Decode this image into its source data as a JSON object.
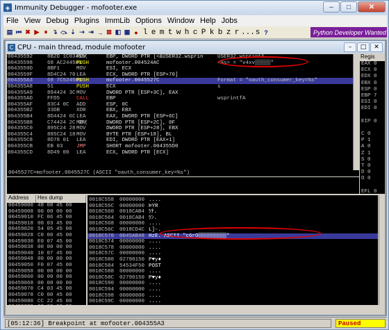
{
  "window": {
    "title": "Immunity Debugger - mofooter.exe",
    "min": "–",
    "max": "□",
    "close": "✕"
  },
  "menu": [
    "File",
    "View",
    "Debug",
    "Plugins",
    "ImmLib",
    "Options",
    "Window",
    "Help",
    "Jobs"
  ],
  "toolbar": {
    "letters": [
      "l",
      "e",
      "m",
      "t",
      "w",
      "h",
      "c",
      "P",
      "k",
      "b",
      "z",
      "r",
      "...",
      "s"
    ],
    "python_banner": "Python Developer Wanted"
  },
  "cpu": {
    "title": "CPU - main thread, module mofooter",
    "disasm": [
      {
        "addr": "00435592",
        "hex": "8B2D 1C03450(",
        "mn": "MOV",
        "op": "EBP, DWORD PTR [<&USER32.wsprin",
        "cm": "USER32.wsprintA",
        "cls": "m-mov"
      },
      {
        "addr": "00435598",
        "hex": "68 AC244500",
        "mn": "PUSH",
        "op": "mofooter.004524AC",
        "cm": "<%s> = \"v4xv▒▒▒▒▒\"",
        "cls": "m-push"
      },
      {
        "addr": "0043559D",
        "hex": "8BF1",
        "mn": "MOV",
        "op": "ESI, ECX",
        "cm": "",
        "cls": "m-mov"
      },
      {
        "addr": "0043559F",
        "hex": "8D4C24 70",
        "mn": "LEA",
        "op": "ECX, DWORD PTR [ESP+70]",
        "cm": "",
        "cls": "m-lea"
      },
      {
        "addr": "004355A3",
        "hex": "68 7C524500",
        "mn": "PUSH",
        "op": "mofooter.0045527C",
        "cm": "Format = \"oauth_consumer_key=%s\"",
        "cls": "m-push",
        "sel": true
      },
      {
        "addr": "004355A8",
        "hex": "51",
        "mn": "PUSH",
        "op": "ECX",
        "cm": "s",
        "cls": "m-push"
      },
      {
        "addr": "004355A9",
        "hex": "894424 3C",
        "mn": "MOV",
        "op": "DWORD PTR [ESP+3C], EAX",
        "cm": "",
        "cls": "m-mov"
      },
      {
        "addr": "004355AD",
        "hex": "FFD5",
        "mn": "CALL",
        "op": "EBP",
        "cm": "wsprintfA",
        "cls": "m-call"
      },
      {
        "addr": "004355AF",
        "hex": "83C4 0C",
        "mn": "ADD",
        "op": "ESP, 0C",
        "cm": "",
        "cls": "m-add"
      },
      {
        "addr": "004355B2",
        "hex": "33DB",
        "mn": "XOR",
        "op": "EBX, EBX",
        "cm": "",
        "cls": "m-xor"
      },
      {
        "addr": "004355B4",
        "hex": "8D4424 6C",
        "mn": "LEA",
        "op": "EAX, DWORD PTR [ESP+6C]",
        "cm": "",
        "cls": "m-lea"
      },
      {
        "addr": "004355B8",
        "hex": "C74424 2C 0F(",
        "mn": "MOV",
        "op": "DWORD PTR [ESP+2C], 0F",
        "cm": "",
        "cls": "m-mov"
      },
      {
        "addr": "004355C0",
        "hex": "895C24 28",
        "mn": "MOV",
        "op": "DWORD PTR [ESP+28], EBX",
        "cm": "",
        "cls": "m-mov"
      },
      {
        "addr": "004355C4",
        "hex": "885C24 18",
        "mn": "MOV",
        "op": "BYTE PTR [ESP+18], BL",
        "cm": "",
        "cls": "m-mov"
      },
      {
        "addr": "004355C8",
        "hex": "8D78 01",
        "mn": "LEA",
        "op": "EDI, DWORD PTR [EAX+1]",
        "cm": "",
        "cls": "m-lea"
      },
      {
        "addr": "004355CB",
        "hex": "EB 03",
        "mn": "JMP",
        "op": "SHORT mofooter.004355D0",
        "cm": "",
        "cls": "m-jmp"
      },
      {
        "addr": "004355CD",
        "hex": "8D49 00",
        "mn": "LEA",
        "op": "ECX, DWORD PTR [ECX]",
        "cm": "",
        "cls": "m-lea"
      }
    ],
    "info_line": "0045527C=mofooter.0045527C (ASCII \"oauth_consumer_key=%s\")",
    "registers_title": "Regis",
    "registers": [
      "EAX 0",
      "ECX 0",
      "EDX 0",
      "EBX 0",
      "ESP 0",
      "EBP 7",
      "ESI 0",
      "EDI 0",
      "",
      "EIP 0",
      "",
      "C 0",
      "P 1",
      "A 0",
      "Z 1",
      "S 0",
      "T 0",
      "D 0",
      "O 0",
      "",
      "EFL 0"
    ],
    "dump_headers": [
      "Address",
      "Hex dump"
    ],
    "dump": [
      [
        "00459000",
        "48 08 45 00"
      ],
      [
        "00459008",
        "00 00 00 00"
      ],
      [
        "00459010",
        "FC 06 45 00"
      ],
      [
        "00459018",
        "00 03 45 00"
      ],
      [
        "00459020",
        "54 05 45 00"
      ],
      [
        "00459028",
        "C0 00 45 00"
      ],
      [
        "00459030",
        "E0 07 45 00"
      ],
      [
        "00459038",
        "00 00 00 00"
      ],
      [
        "00459040",
        "10 07 45 00"
      ],
      [
        "00459048",
        "00 00 00 00"
      ],
      [
        "00459050",
        "F0 07 45 00"
      ],
      [
        "00459058",
        "00 00 00 00"
      ],
      [
        "00459060",
        "00 00 00 00"
      ],
      [
        "00459068",
        "00 00 00 00"
      ],
      [
        "00459070",
        "C4 03 45 00"
      ],
      [
        "00459078",
        "C0 00 45 00"
      ],
      [
        "00459080",
        "CC 22 45 00"
      ],
      [
        "00459088",
        "00 00 00 00"
      ]
    ],
    "stack": [
      {
        "a": "0018C558",
        "v": "00000000",
        "c": "...."
      },
      {
        "a": "0018C55C",
        "v": "00000000",
        "c": "ÞYR"
      },
      {
        "a": "0018C560",
        "v": "0018CAB4",
        "c": "ﾂﾅ."
      },
      {
        "a": "0018C564",
        "v": "0018CAB4",
        "c": "ﾂﾝ."
      },
      {
        "a": "0018C568",
        "v": "00000000",
        "c": "...."
      },
      {
        "a": "0018C56C",
        "v": "0018CD4C",
        "c": "L]-."
      },
      {
        "a": "0018C570",
        "v": "0045AB48",
        "c": "HzE.",
        "cm": "ASCII \"c6rO▒▒▒▒▒▒▒▒▒\"",
        "sel": true
      },
      {
        "a": "0018C574",
        "v": "00000000",
        "c": "...."
      },
      {
        "a": "0018C578",
        "v": "00000000",
        "c": "...."
      },
      {
        "a": "0018C57C",
        "v": "00000000",
        "c": "...."
      },
      {
        "a": "0018C580",
        "v": "02790150",
        "c": "P♥y♦"
      },
      {
        "a": "0018C584",
        "v": "54534F50",
        "c": "POST"
      },
      {
        "a": "0018C588",
        "v": "00000000",
        "c": "...."
      },
      {
        "a": "0018C58C",
        "v": "02790150",
        "c": "P♥y♦"
      },
      {
        "a": "0018C590",
        "v": "00000000",
        "c": "...."
      },
      {
        "a": "0018C594",
        "v": "00000000",
        "c": "...."
      },
      {
        "a": "0018C598",
        "v": "00000000",
        "c": "...."
      },
      {
        "a": "0018C59C",
        "v": "00000000",
        "c": "...."
      }
    ]
  },
  "status": {
    "message": "[05:12:36] Breakpoint at mofooter.004355A3",
    "state": "Paused"
  }
}
